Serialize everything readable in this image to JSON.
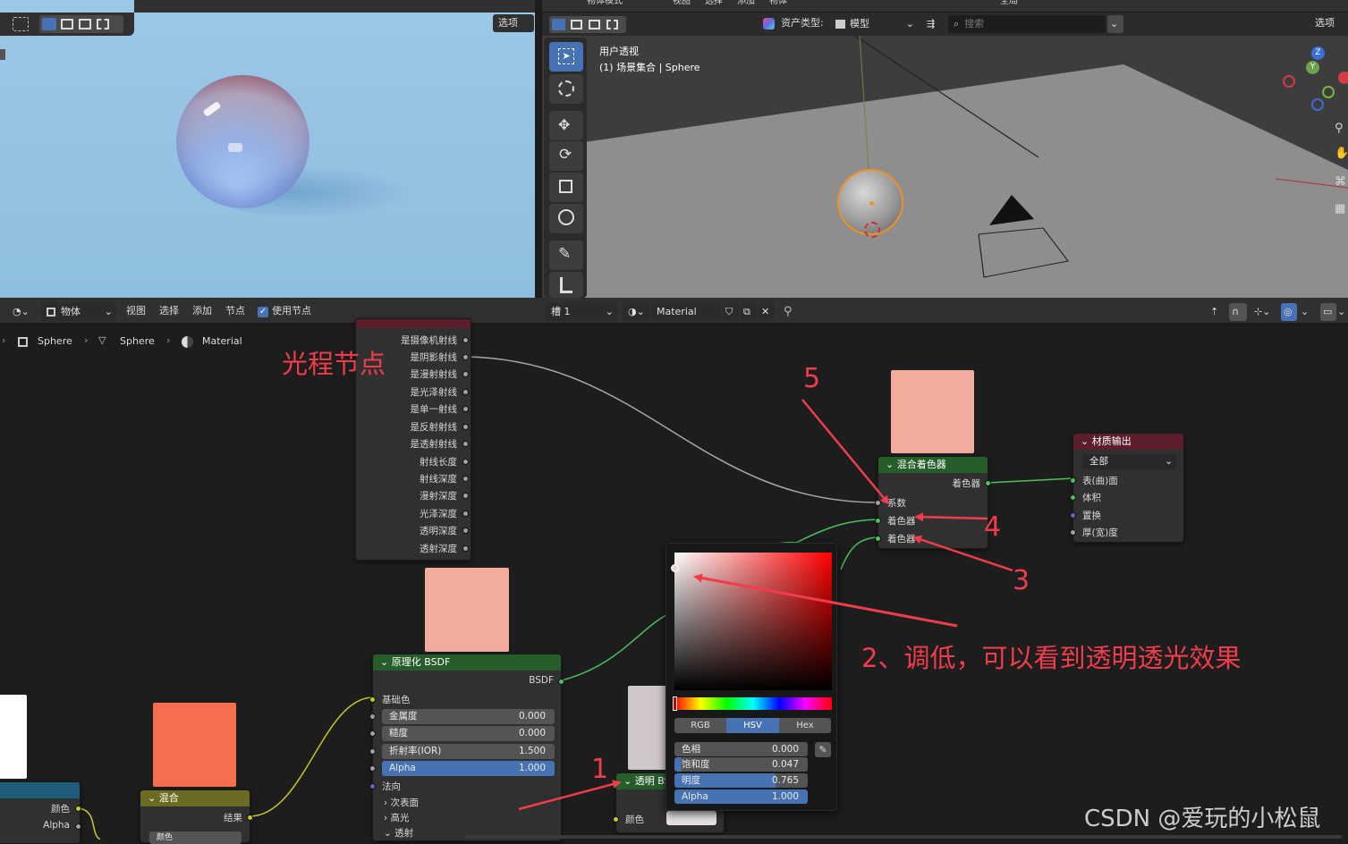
{
  "render_view": {
    "options_label": "选项"
  },
  "viewport3d": {
    "mode_label": "物体模式",
    "menus": [
      "视图",
      "选择",
      "添加",
      "物体"
    ],
    "global_label": "全局",
    "options_label": "选项",
    "asset_type_label": "资产类型:",
    "asset_type_value": "模型",
    "search_placeholder": "搜索",
    "view_name": "用户透视",
    "collection_label": "(1) 场景集合 | Sphere",
    "gizmo": {
      "z": "Z",
      "y": "Y"
    }
  },
  "node_editor": {
    "object_label": "物体",
    "menus": [
      "视图",
      "选择",
      "添加",
      "节点"
    ],
    "use_nodes_label": "使用节点",
    "slot_label": "槽 1",
    "material_name": "Material",
    "breadcrumb": [
      "Sphere",
      "Sphere",
      "Material"
    ]
  },
  "light_path_node": {
    "outputs": [
      "是摄像机射线",
      "是阴影射线",
      "是漫射射线",
      "是光泽射线",
      "是单一射线",
      "是反射射线",
      "是透射射线",
      "射线长度",
      "射线深度",
      "漫射深度",
      "光泽深度",
      "透明深度",
      "透射深度"
    ]
  },
  "mix_shader_node": {
    "title": "混合着色器",
    "output": "着色器",
    "inputs": [
      "系数",
      "着色器",
      "着色器"
    ]
  },
  "output_node": {
    "title": "材质输出",
    "target": "全部",
    "inputs": [
      "表(曲)面",
      "体积",
      "置换",
      "厚(宽)度"
    ]
  },
  "principled_node": {
    "title": "原理化 BSDF",
    "output": "BSDF",
    "base_color_label": "基础色",
    "fields": [
      {
        "label": "金属度",
        "value": "0.000"
      },
      {
        "label": "糙度",
        "value": "0.000"
      },
      {
        "label": "折射率(IOR)",
        "value": "1.500"
      },
      {
        "label": "Alpha",
        "value": "1.000"
      }
    ],
    "normal_label": "法向",
    "panels": [
      "次表面",
      "高光",
      "透射"
    ]
  },
  "mix_node": {
    "title": "混合",
    "output": "结果",
    "input_partial": "颜色"
  },
  "left_node": {
    "outputs": [
      "颜色",
      "Alpha"
    ]
  },
  "transparent_node": {
    "title": "透明 BS",
    "input": "颜色"
  },
  "color_picker": {
    "tabs": [
      "RGB",
      "HSV",
      "Hex"
    ],
    "active_tab": "HSV",
    "fields": [
      {
        "label": "色相",
        "value": "0.000"
      },
      {
        "label": "饱和度",
        "value": "0.047"
      },
      {
        "label": "明度",
        "value": "0.765"
      },
      {
        "label": "Alpha",
        "value": "1.000"
      }
    ]
  },
  "annotations": {
    "light_path_note": "光程节点",
    "step1": "1",
    "step2": "2、调低，可以看到透明透光效果",
    "step3": "3",
    "step4": "4",
    "step5": "5"
  },
  "watermark": "CSDN @爱玩的小松鼠",
  "colors": {
    "accent": "#4772b3",
    "shader_header": "#255e2a",
    "output_header": "#5b1e2a",
    "mix_header": "#6b6b22",
    "texture_header": "#1f5d7a",
    "salmon_preview": "#f2ab9c",
    "orange_preview": "#f56e50",
    "annotation_red": "#f03c4b"
  }
}
